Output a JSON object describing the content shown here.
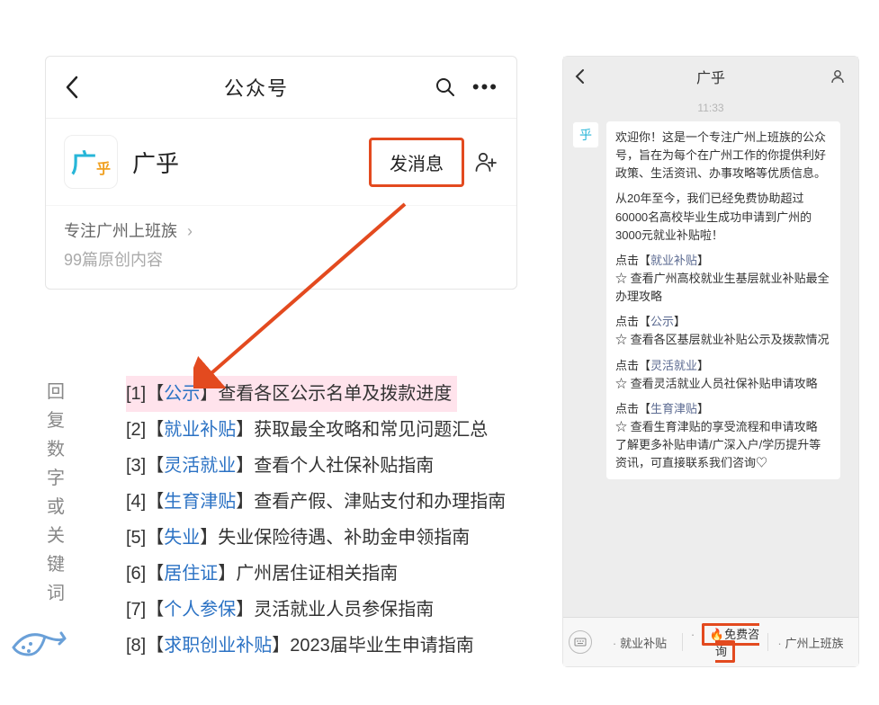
{
  "profile": {
    "header_title": "公众号",
    "name": "广乎",
    "send_label": "发消息",
    "desc": "专注广州上班族",
    "content_count": "99篇原创内容"
  },
  "hint_vertical": "回复数字或关键词",
  "kw_list": [
    {
      "idx": "[1]",
      "kw": "公示",
      "desc": "查看各区公示名单及拨款进度",
      "highlight": true
    },
    {
      "idx": "[2]",
      "kw": "就业补贴",
      "desc": "获取最全攻略和常见问题汇总",
      "highlight": false
    },
    {
      "idx": "[3]",
      "kw": "灵活就业",
      "desc": "查看个人社保补贴指南",
      "highlight": false
    },
    {
      "idx": "[4]",
      "kw": "生育津贴",
      "desc": "查看产假、津贴支付和办理指南",
      "highlight": false
    },
    {
      "idx": "[5]",
      "kw": "失业",
      "desc": "失业保险待遇、补助金申领指南",
      "highlight": false
    },
    {
      "idx": "[6]",
      "kw": "居住证",
      "desc": "广州居住证相关指南",
      "highlight": false
    },
    {
      "idx": "[7]",
      "kw": "个人参保",
      "desc": "灵活就业人员参保指南",
      "highlight": false
    },
    {
      "idx": "[8]",
      "kw": "求职创业补贴",
      "desc": "2023届毕业生申请指南",
      "highlight": false
    }
  ],
  "phone": {
    "title": "广乎",
    "time": "11:33",
    "welcome_p1": "欢迎你！这是一个专注广州上班族的公众号，旨在为每个在广州工作的你提供利好政策、生活资讯、办事攻略等优质信息。",
    "welcome_p2": "从20年至今，我们已经免费协助超过60000名高校毕业生成功申请到广州的3000元就业补贴啦！",
    "links": [
      {
        "label": "就业补贴",
        "text": "☆ 查看广州高校就业生基层就业补贴最全办理攻略"
      },
      {
        "label": "公示",
        "text": "☆ 查看各区基层就业补贴公示及拨款情况"
      },
      {
        "label": "灵活就业",
        "text": "☆ 查看灵活就业人员社保补贴申请攻略"
      },
      {
        "label": "生育津贴",
        "text": "☆ 查看生育津贴的享受流程和申请攻略"
      }
    ],
    "footer_text": "了解更多补贴申请/广深入户/学历提升等资讯，可直接联系我们咨询♡",
    "click_prefix": "点击【",
    "click_suffix": "】",
    "bottom": {
      "left": "就业补贴",
      "mid": "免费咨询",
      "right": "广州上班族"
    }
  }
}
